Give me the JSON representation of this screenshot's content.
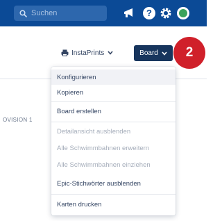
{
  "topbar": {
    "search_placeholder": "Suchen",
    "icons": [
      "search-icon",
      "megaphone-icon",
      "help-icon",
      "settings-icon",
      "avatar"
    ],
    "help_glyph": "?"
  },
  "toolbar": {
    "instaprints_label": "InstaPrints",
    "board_label": "Board"
  },
  "callout": {
    "number": "2"
  },
  "column": {
    "label": "OVISION 1"
  },
  "menu": {
    "items": [
      {
        "label": "Konfigurieren",
        "state": "hover"
      },
      {
        "label": "Kopieren",
        "state": "enabled"
      },
      {
        "label": "Board erstellen",
        "state": "enabled"
      },
      {
        "label": "Detailansicht ausblenden",
        "state": "disabled"
      },
      {
        "label": "Alle Schwimmbahnen erweitern",
        "state": "disabled"
      },
      {
        "label": "Alle Schwimmbahnen einziehen",
        "state": "disabled"
      },
      {
        "label": "Epic-Stichwörter ausblenden",
        "state": "enabled"
      },
      {
        "label": "Karten drucken",
        "state": "enabled"
      }
    ]
  },
  "colors": {
    "topbar": "#0b4a96",
    "board_button": "#17355d",
    "badge": "#d0202a"
  }
}
